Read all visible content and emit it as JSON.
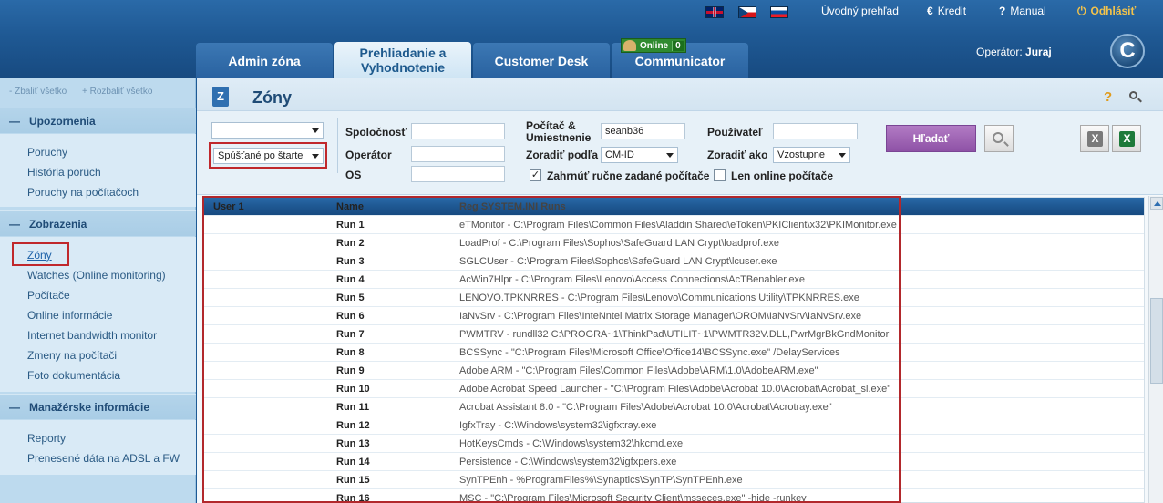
{
  "header": {
    "links": {
      "overview": "Úvodný prehľad",
      "credit": "Kredit",
      "manual": "Manual",
      "logout": "Odhlásiť"
    },
    "icons": {
      "credit": "euro-icon",
      "manual": "question-icon",
      "logout": "power-icon"
    },
    "tabs": [
      {
        "label": "Admin zóna"
      },
      {
        "label_line1": "Prehliadanie a",
        "label_line2": "Vyhodnotenie"
      },
      {
        "label": "Customer Desk"
      },
      {
        "label": "Communicator"
      }
    ],
    "online_badge": {
      "label": "Online",
      "count": "0"
    },
    "operator": {
      "label": "Operátor:",
      "name": "Juraj"
    },
    "logo_letter": "C"
  },
  "sidebar": {
    "collapse_all": "- Zbaliť všetko",
    "expand_all": "+ Rozbaliť všetko",
    "sections": [
      {
        "title": "Upozornenia",
        "items": [
          "Poruchy",
          "História porúch",
          "Poruchy na počítačoch"
        ]
      },
      {
        "title": "Zobrazenia",
        "items": [
          "Zóny",
          "Watches (Online monitoring)",
          "Počítače",
          "Online informácie",
          "Internet bandwidth monitor",
          "Zmeny na počítači",
          "Foto dokumentácia"
        ]
      },
      {
        "title": "Manažérske informácie",
        "items": [
          "Reporty",
          "Prenesené dáta na ADSL a FW"
        ]
      }
    ]
  },
  "main": {
    "title": "Zóny",
    "filters": {
      "select_top": "",
      "select_bottom": "Spúšťané po štarte",
      "company_label": "Spoločnosť",
      "company_value": "",
      "operator_label": "Operátor",
      "operator_value": "",
      "os_label": "OS",
      "os_value": "",
      "computer_label_line1": "Počítač &",
      "computer_label_line2": "Umiestnenie",
      "computer_value": "seanb36",
      "sort_by_label": "Zoradiť podľa",
      "sort_by_value": "CM-ID",
      "include_manual_label": "Zahrnúť ručne zadané počítače",
      "include_manual_checked": "✓",
      "user_label": "Používateľ",
      "user_value": "",
      "sort_as_label": "Zoradiť ako",
      "sort_as_value": "Vzostupne",
      "online_only_label": "Len online počítače",
      "search_button": "Hľadať"
    },
    "grid": {
      "columns": [
        "User 1",
        "Name",
        "Reg SYSTEM.INI Runs"
      ],
      "rows": [
        {
          "name": "Run 1",
          "value": "eTMonitor - C:\\Program Files\\Common Files\\Aladdin Shared\\eToken\\PKIClient\\x32\\PKIMonitor.exe"
        },
        {
          "name": "Run 2",
          "value": "LoadProf - C:\\Program Files\\Sophos\\SafeGuard LAN Crypt\\loadprof.exe"
        },
        {
          "name": "Run 3",
          "value": "SGLCUser - C:\\Program Files\\Sophos\\SafeGuard LAN Crypt\\lcuser.exe"
        },
        {
          "name": "Run 4",
          "value": "AcWin7Hlpr - C:\\Program Files\\Lenovo\\Access Connections\\AcTBenabler.exe"
        },
        {
          "name": "Run 5",
          "value": "LENOVO.TPKNRRES - C:\\Program Files\\Lenovo\\Communications Utility\\TPKNRRES.exe"
        },
        {
          "name": "Run 6",
          "value": "IaNvSrv - C:\\Program Files\\InteNntel Matrix Storage Manager\\OROM\\IaNvSrv\\IaNvSrv.exe"
        },
        {
          "name": "Run 7",
          "value": "PWMTRV - rundll32 C:\\PROGRA~1\\ThinkPad\\UTILIT~1\\PWMTR32V.DLL,PwrMgrBkGndMonitor"
        },
        {
          "name": "Run 8",
          "value": "BCSSync - \"C:\\Program Files\\Microsoft Office\\Office14\\BCSSync.exe\" /DelayServices"
        },
        {
          "name": "Run 9",
          "value": "Adobe ARM - \"C:\\Program Files\\Common Files\\Adobe\\ARM\\1.0\\AdobeARM.exe\""
        },
        {
          "name": "Run 10",
          "value": "Adobe Acrobat Speed Launcher - \"C:\\Program Files\\Adobe\\Acrobat 10.0\\Acrobat\\Acrobat_sl.exe\""
        },
        {
          "name": "Run 11",
          "value": "Acrobat Assistant 8.0 - \"C:\\Program Files\\Adobe\\Acrobat 10.0\\Acrobat\\Acrotray.exe\""
        },
        {
          "name": "Run 12",
          "value": "IgfxTray - C:\\Windows\\system32\\igfxtray.exe"
        },
        {
          "name": "Run 13",
          "value": "HotKeysCmds - C:\\Windows\\system32\\hkcmd.exe"
        },
        {
          "name": "Run 14",
          "value": "Persistence - C:\\Windows\\system32\\igfxpers.exe"
        },
        {
          "name": "Run 15",
          "value": "SynTPEnh - %ProgramFiles%\\Synaptics\\SynTP\\SynTPEnh.exe"
        },
        {
          "name": "Run 16",
          "value": "MSC - \"C:\\Program Files\\Microsoft Security Client\\msseces.exe\" -hide -runkey"
        }
      ]
    }
  }
}
